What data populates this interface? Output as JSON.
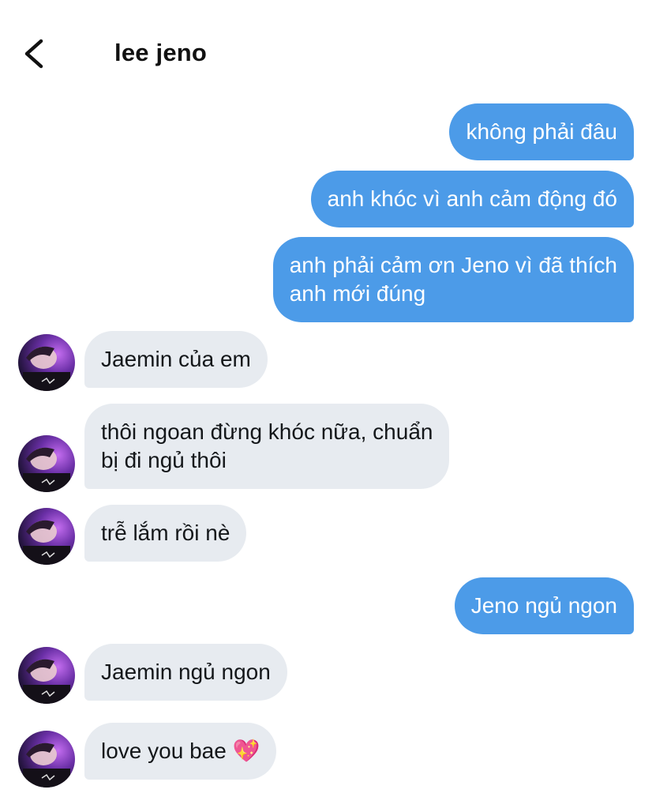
{
  "header": {
    "back_icon": "chevron-left-icon",
    "title": "lee jeno"
  },
  "colors": {
    "outgoing_bubble": "#4c9be8",
    "incoming_bubble": "#e7ebf0",
    "outgoing_text": "#ffffff",
    "incoming_text": "#14171a"
  },
  "messages": [
    {
      "direction": "outgoing",
      "text": "không phải đâu"
    },
    {
      "direction": "outgoing",
      "text": "anh khóc vì anh cảm động đó"
    },
    {
      "direction": "outgoing",
      "lines": [
        "anh phải cảm ơn Jeno vì đã thích",
        "anh mới đúng"
      ]
    },
    {
      "direction": "incoming",
      "text": "Jaemin của em"
    },
    {
      "direction": "incoming",
      "lines": [
        "thôi ngoan đừng khóc nữa, chuẩn",
        "bị đi ngủ thôi"
      ]
    },
    {
      "direction": "incoming",
      "text": "trễ lắm rồi nè"
    },
    {
      "direction": "outgoing",
      "text": "Jeno ngủ ngon"
    },
    {
      "direction": "incoming",
      "text": "Jaemin ngủ ngon"
    },
    {
      "direction": "incoming",
      "text": "love you bae 💖"
    }
  ]
}
